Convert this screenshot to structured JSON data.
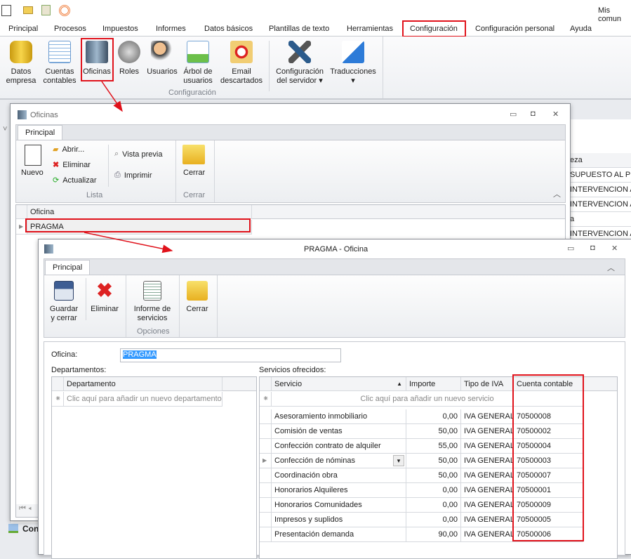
{
  "app": {
    "right_text": "Mis comun",
    "menu": [
      "Principal",
      "Procesos",
      "Impuestos",
      "Informes",
      "Datos básicos",
      "Plantillas de texto",
      "Herramientas",
      "Configuración",
      "Configuración personal",
      "Ayuda"
    ],
    "ribbon": [
      {
        "label": "Datos\nempresa"
      },
      {
        "label": "Cuentas\ncontables"
      },
      {
        "label": "Oficinas"
      },
      {
        "label": "Roles"
      },
      {
        "label": "Usuarios"
      },
      {
        "label": "Árbol de\nusuarios"
      },
      {
        "label": "Email\ndescartados"
      },
      {
        "label": "Configuración\ndel servidor ▾"
      },
      {
        "label": "Traducciones\n▾"
      }
    ],
    "group_label": "Configuración",
    "bg_grid": {
      "header": "eza",
      "rows": [
        "SUPUESTO AL PRES",
        "INTERVENCION AL",
        "INTERVENCION AL",
        "a",
        "INTERVENCION AL"
      ]
    },
    "bottom_text": "Con"
  },
  "oficinas": {
    "title": "Oficinas",
    "tab": "Principal",
    "nuevo": "Nuevo",
    "abrir": "Abrir...",
    "eliminar": "Eliminar",
    "actualizar": "Actualizar",
    "vista_previa": "Vista previa",
    "imprimir": "Imprimir",
    "cerrar": "Cerrar",
    "group_lista": "Lista",
    "group_cerrar": "Cerrar",
    "col": "Oficina",
    "row": "PRAGMA"
  },
  "pragma": {
    "title": "PRAGMA - Oficina",
    "tab": "Principal",
    "guardar": "Guardar\ny cerrar",
    "eliminar": "Eliminar",
    "informe": "Informe de\nservicios",
    "cerrar": "Cerrar",
    "group_opciones": "Opciones",
    "oficina_label": "Oficina:",
    "oficina_value": "PRAGMA",
    "dept_label": "Departamentos:",
    "dept_col": "Departamento",
    "dept_add": "Clic aquí para añadir un nuevo departamento",
    "serv_label": "Servicios ofrecidos:",
    "serv_cols": [
      "Servicio",
      "Importe",
      "Tipo de IVA",
      "Cuenta contable"
    ],
    "serv_add": "Clic aquí para añadir un nuevo servicio",
    "rows": [
      [
        "Asesoramiento inmobiliario",
        "0,00",
        "IVA GENERAL",
        "70500008"
      ],
      [
        "Comisión de ventas",
        "50,00",
        "IVA GENERAL",
        "70500002"
      ],
      [
        "Confección contrato de alquiler",
        "55,00",
        "IVA GENERAL",
        "70500004"
      ],
      [
        "Confección de nóminas",
        "50,00",
        "IVA GENERAL",
        "70500003"
      ],
      [
        "Coordinación obra",
        "50,00",
        "IVA GENERAL",
        "70500007"
      ],
      [
        "Honorarios Alquileres",
        "0,00",
        "IVA GENERAL",
        "70500001"
      ],
      [
        "Honorarios Comunidades",
        "0,00",
        "IVA GENERAL",
        "70500009"
      ],
      [
        "Impresos y suplidos",
        "0,00",
        "IVA GENERAL",
        "70500005"
      ],
      [
        "Presentación demanda",
        "90,00",
        "IVA GENERAL",
        "70500006"
      ]
    ]
  },
  "colors": {
    "highlight": "#e0121b",
    "selection": "#3399ff"
  }
}
